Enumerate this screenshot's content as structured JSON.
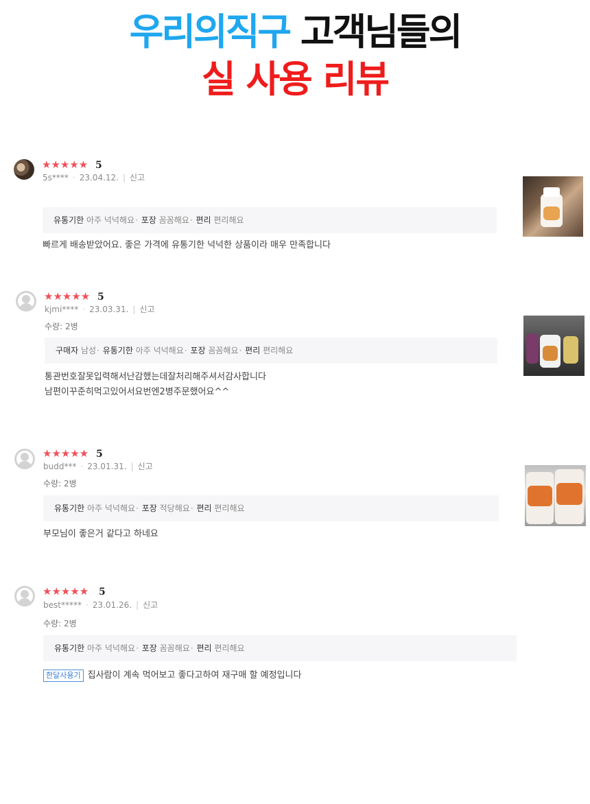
{
  "hero": {
    "line1_blue": "우리의직구",
    "line1_black": " 고객님들의",
    "line2_red": "실 사용 리뷰"
  },
  "reviews": [
    {
      "stars": "★★★★★",
      "score": "5",
      "user": "5s****",
      "date": "23.04.12.",
      "report": "신고",
      "quantity": "",
      "tags": [
        {
          "key": "유통기한",
          "value": "아주 넉넉해요"
        },
        {
          "key": "포장",
          "value": "꼼꼼해요"
        },
        {
          "key": "편리",
          "value": "편리해요"
        }
      ],
      "badge": "",
      "body": [
        "빠르게 배송받았어요. 좋은 가격에 유통기한 넉넉한 상품이라 매우 만족합니다"
      ]
    },
    {
      "stars": "★★★★★",
      "score": "5",
      "user": "kjmi****",
      "date": "23.03.31.",
      "report": "신고",
      "quantity": "수량: 2병",
      "tags": [
        {
          "key": "구매자",
          "value": "남성"
        },
        {
          "key": "유통기한",
          "value": "아주 넉넉해요"
        },
        {
          "key": "포장",
          "value": "꼼꼼해요"
        },
        {
          "key": "편리",
          "value": "편리해요"
        }
      ],
      "badge": "",
      "body": [
        "통관번호잘못입력해서난감했는데잘처리해주셔서감사합니다",
        "남편이꾸준히먹고있어서요번엔2병주문했어요^^"
      ]
    },
    {
      "stars": "★★★★★",
      "score": "5",
      "user": "budd***",
      "date": "23.01.31.",
      "report": "신고",
      "quantity": "수량: 2병",
      "tags": [
        {
          "key": "유통기한",
          "value": "아주 넉넉해요"
        },
        {
          "key": "포장",
          "value": "적당해요"
        },
        {
          "key": "편리",
          "value": "편리해요"
        }
      ],
      "badge": "",
      "body": [
        "부모님이 좋은거 같다고 하네요"
      ]
    },
    {
      "stars": "★★★★★",
      "score": "5",
      "user": "best*****",
      "date": "23.01.26.",
      "report": "신고",
      "quantity": "수량: 2병",
      "tags": [
        {
          "key": "유통기한",
          "value": "아주 넉넉해요"
        },
        {
          "key": "포장",
          "value": "꼼꼼해요"
        },
        {
          "key": "편리",
          "value": "편리해요"
        }
      ],
      "badge": "한달사용기",
      "body": [
        "집사람이 계속 먹어보고 좋다고하여 재구매 할 예정입니다"
      ]
    }
  ],
  "colors": {
    "hero_blue": "#1fa7ef",
    "hero_red": "#ef1c1c",
    "highlight_yellow": "#ffe600",
    "star_red": "#f0505a",
    "badge_blue": "#3a7ccf",
    "tag_background": "#f6f6f8"
  }
}
